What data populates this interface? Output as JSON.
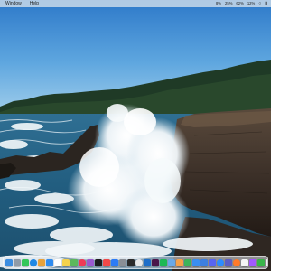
{
  "menubar": {
    "items": [
      "Window",
      "Help"
    ],
    "status": [
      {
        "value": "8%"
      },
      {
        "value": "25%"
      },
      {
        "value": "62%"
      },
      {
        "value": "12%"
      }
    ],
    "icons": [
      "wifi-icon",
      "battery-icon"
    ]
  },
  "desktop": {
    "wallpaper": "coastal-wave-crashing-rocks-photo"
  },
  "dock": {
    "apps": [
      {
        "name": "finder",
        "color": "#3b8de0"
      },
      {
        "name": "launchpad",
        "color": "#8f9ba8"
      },
      {
        "name": "messages",
        "color": "#34c759"
      },
      {
        "name": "safari",
        "color": "#1e88e5"
      },
      {
        "name": "photos",
        "color": "#e9a23b"
      },
      {
        "name": "mail",
        "color": "#2f8cf0"
      },
      {
        "name": "calendar",
        "color": "#ffffff"
      },
      {
        "name": "notes",
        "color": "#f4d24c"
      },
      {
        "name": "maps",
        "color": "#5cb85c"
      },
      {
        "name": "music",
        "color": "#f03a56"
      },
      {
        "name": "podcasts",
        "color": "#9b59d0"
      },
      {
        "name": "tv",
        "color": "#1c1c1e"
      },
      {
        "name": "news",
        "color": "#f04949"
      },
      {
        "name": "app-store",
        "color": "#2c7cf6"
      },
      {
        "name": "system-settings",
        "color": "#8a8f96"
      },
      {
        "name": "terminal",
        "color": "#2b2b2b"
      },
      {
        "name": "chrome",
        "color": "#e8e8e8"
      },
      {
        "name": "vscode",
        "color": "#1f6fc9"
      },
      {
        "name": "slack",
        "color": "#4a154b"
      },
      {
        "name": "spotify",
        "color": "#1db954"
      },
      {
        "name": "preview",
        "color": "#6aa9e8"
      },
      {
        "name": "pages",
        "color": "#f6a14a"
      },
      {
        "name": "numbers",
        "color": "#3db35a"
      },
      {
        "name": "keynote",
        "color": "#3a8ef0"
      },
      {
        "name": "xcode",
        "color": "#3d7fe0"
      },
      {
        "name": "discord",
        "color": "#5865f2"
      },
      {
        "name": "zoom",
        "color": "#2d8cff"
      },
      {
        "name": "teams",
        "color": "#5b5fc7"
      },
      {
        "name": "firefox",
        "color": "#ff7a2a"
      },
      {
        "name": "notion",
        "color": "#f5f5f5"
      },
      {
        "name": "figma",
        "color": "#a259ff"
      },
      {
        "name": "activity-monitor",
        "color": "#39b54a"
      },
      {
        "name": "reminders",
        "color": "#f2f2f2"
      }
    ],
    "trailing": [
      {
        "name": "downloads",
        "color": "#5aa0e8"
      },
      {
        "name": "trash",
        "color": "#c9ced4"
      }
    ]
  }
}
